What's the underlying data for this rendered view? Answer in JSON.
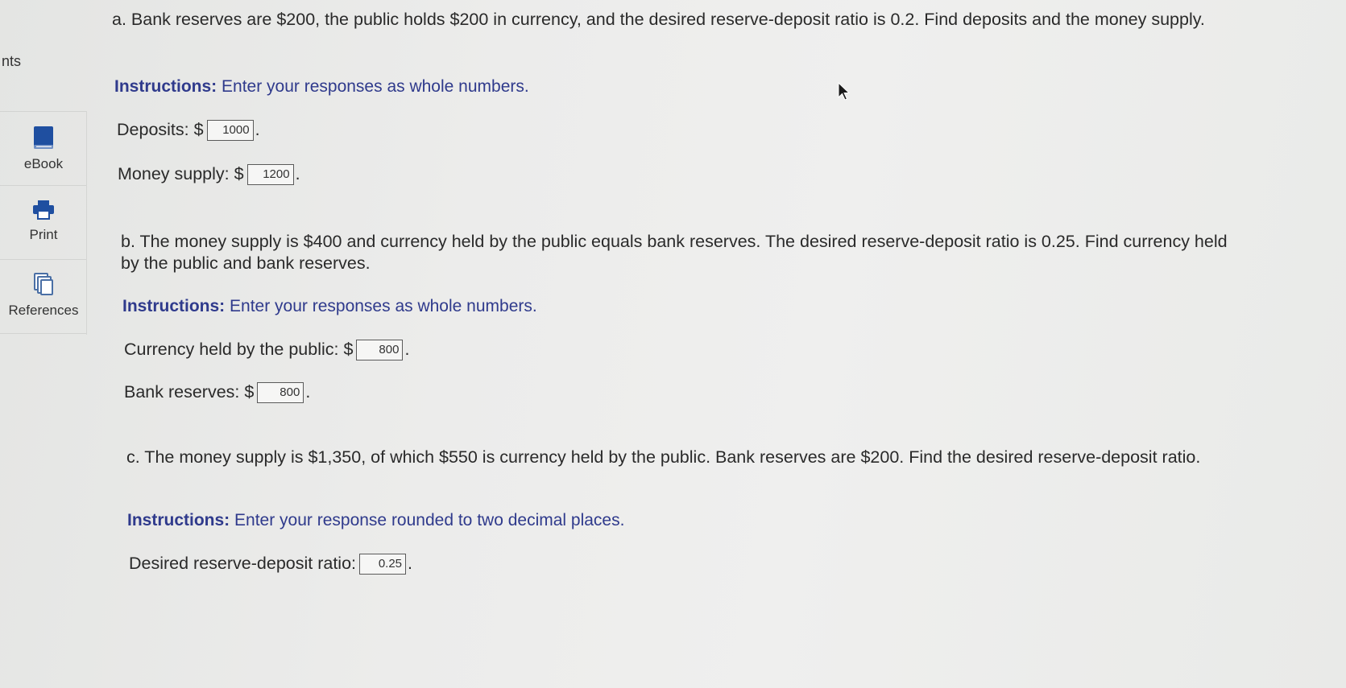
{
  "sidebar": {
    "partial_label": "nts",
    "items": [
      {
        "label": "eBook",
        "icon": "book-icon"
      },
      {
        "label": "Print",
        "icon": "printer-icon"
      },
      {
        "label": "References",
        "icon": "documents-icon"
      }
    ]
  },
  "questions": {
    "a": {
      "prompt": "a. Bank reserves are $200, the public holds $200 in currency, and the desired reserve-deposit ratio is 0.2. Find deposits and the money supply.",
      "instr_bold": "Instructions:",
      "instr_text": " Enter your responses as whole numbers.",
      "fields": [
        {
          "label": "Deposits: $",
          "value": "1000"
        },
        {
          "label": "Money supply: $",
          "value": "1200"
        }
      ]
    },
    "b": {
      "prompt": "b. The money supply is $400 and currency held by the public equals bank reserves. The desired reserve-deposit ratio is 0.25. Find currency held by the public and bank reserves.",
      "instr_bold": "Instructions:",
      "instr_text": " Enter your responses as whole numbers.",
      "fields": [
        {
          "label": "Currency held by the public: $",
          "value": "800"
        },
        {
          "label": "Bank reserves: $",
          "value": "800"
        }
      ]
    },
    "c": {
      "prompt": "c. The money supply is $1,350, of which $550 is currency held by the public. Bank reserves are $200. Find the desired reserve-deposit ratio.",
      "instr_bold": "Instructions:",
      "instr_text": " Enter your response rounded to two decimal places.",
      "fields": [
        {
          "label": "Desired reserve-deposit ratio:",
          "value": "0.25"
        }
      ]
    }
  },
  "colors": {
    "instruction": "#2f3a8c",
    "ebook_icon": "#1f4fa0",
    "print_icon": "#1f4fa0",
    "references_icon": "#4a6fa5"
  }
}
